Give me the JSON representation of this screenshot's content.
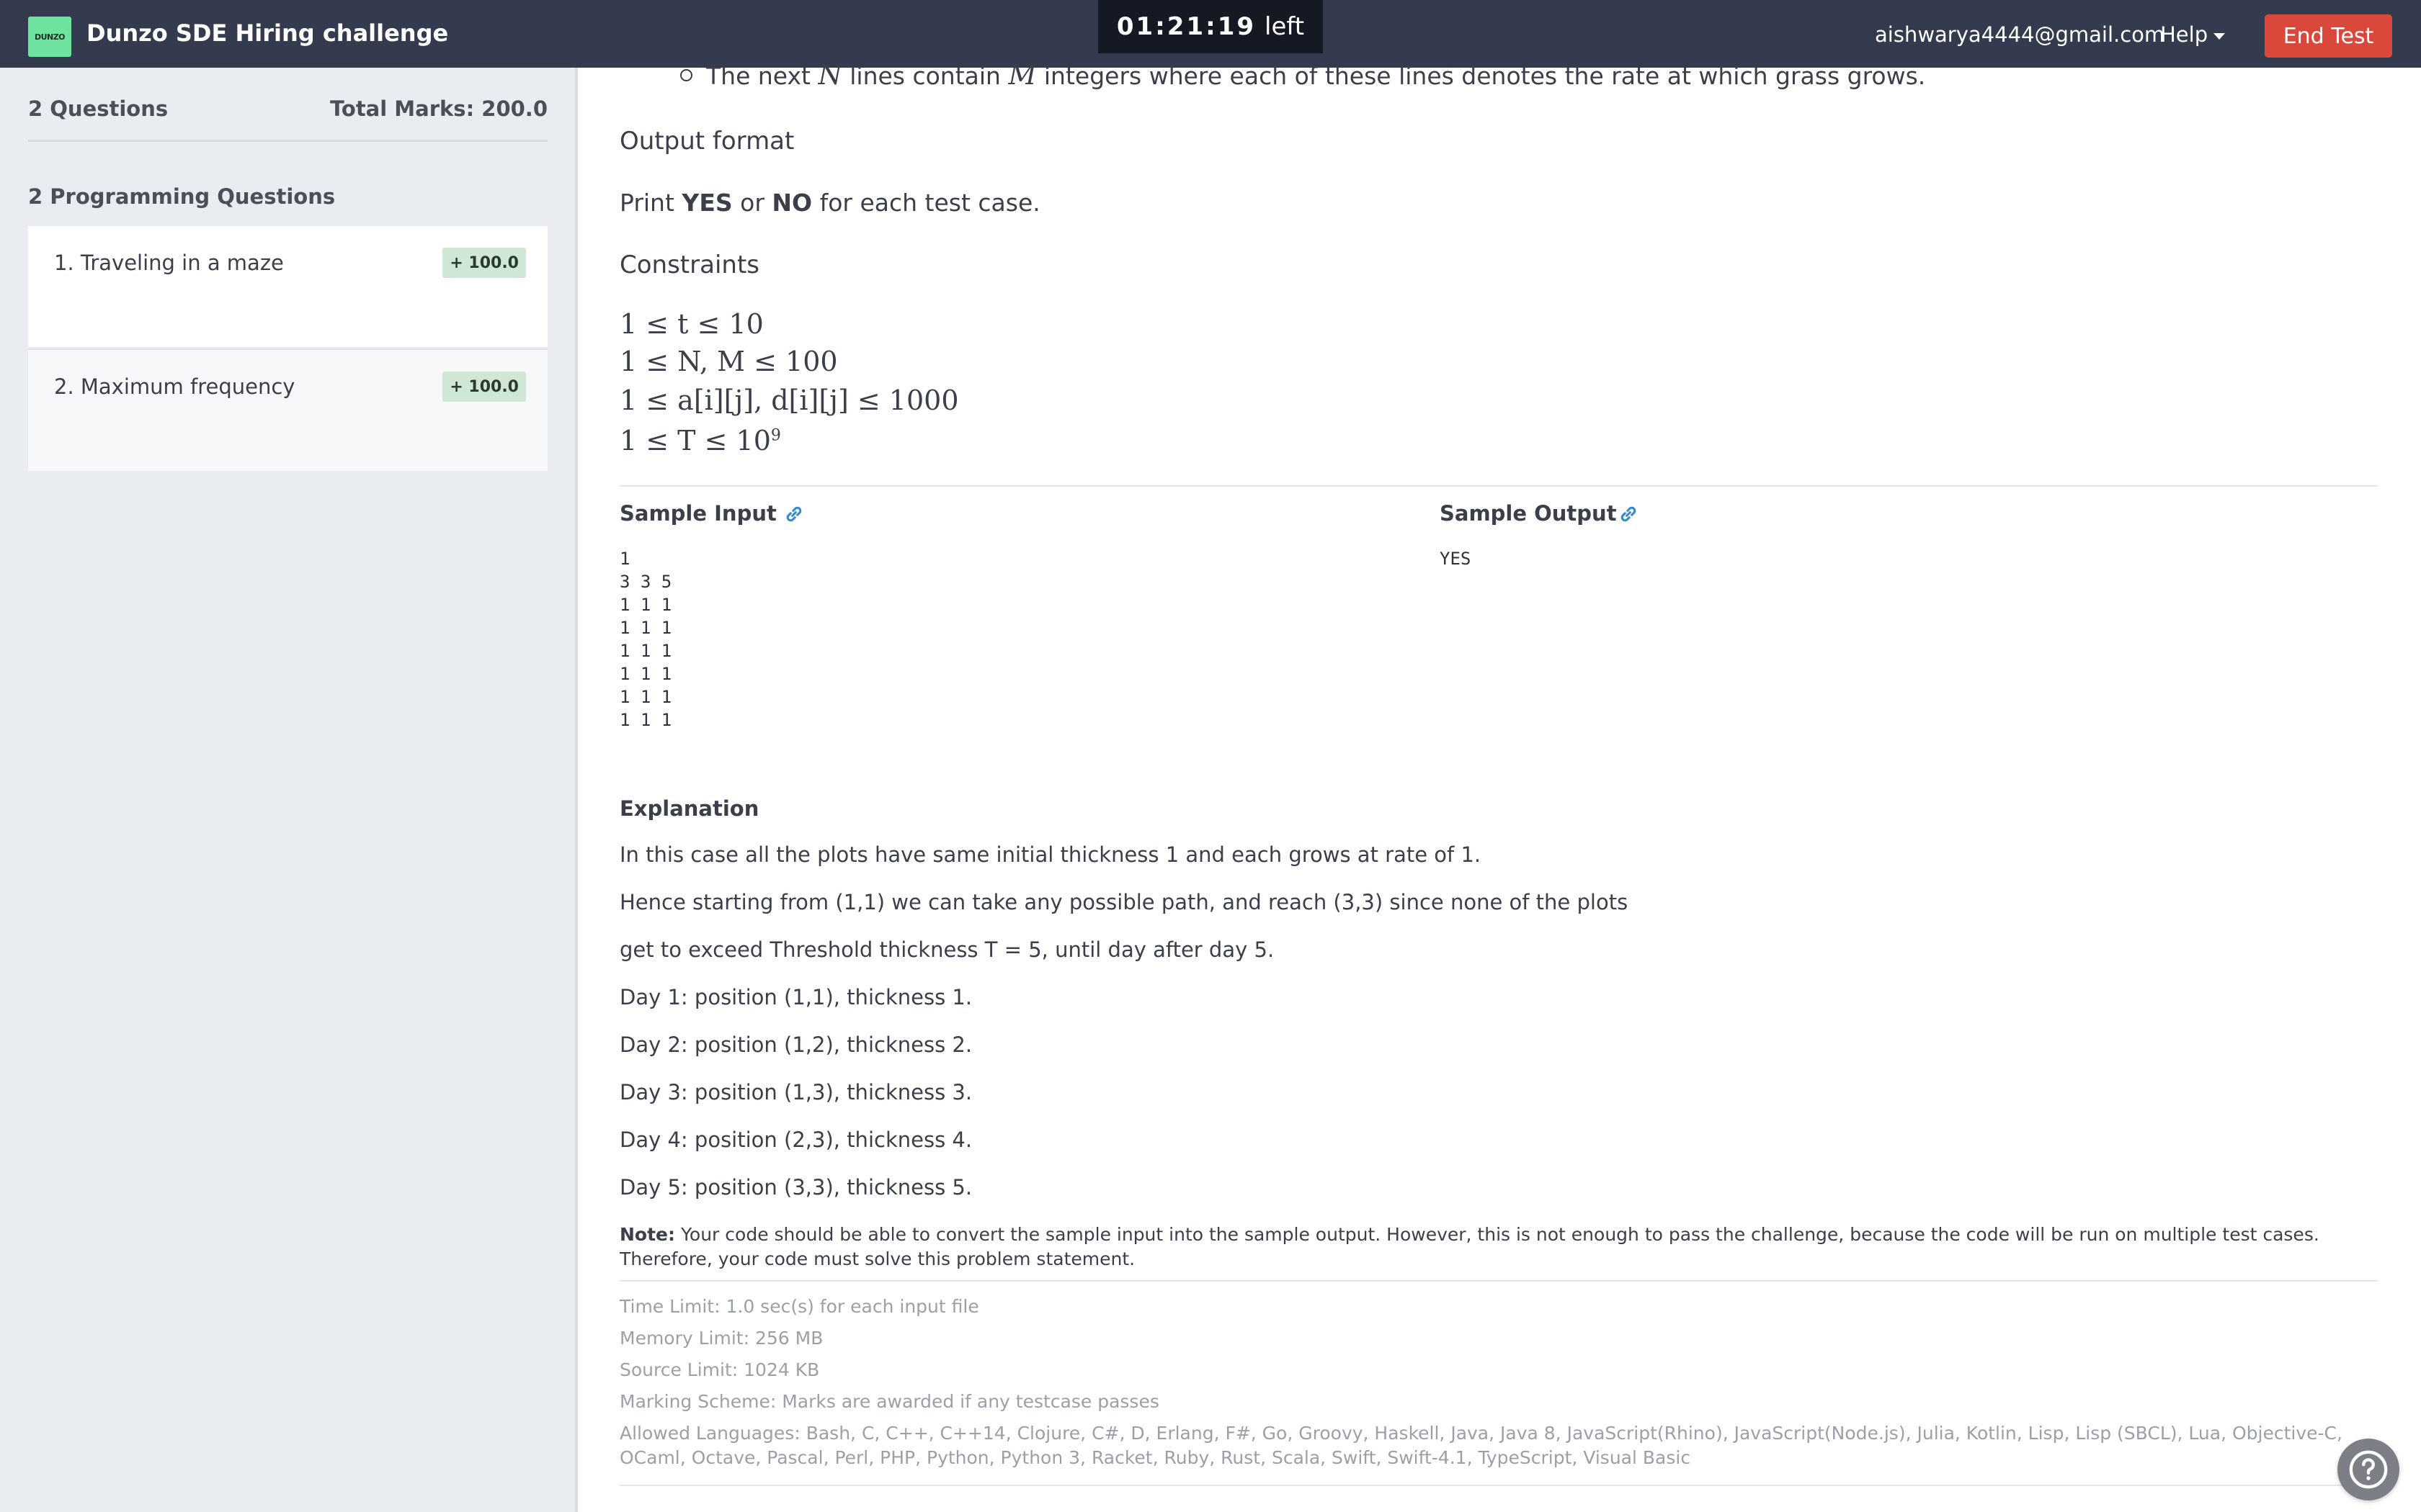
{
  "header": {
    "logo_text": "DUNZO",
    "title": "Dunzo SDE Hiring challenge",
    "timer_value": "01:21:19",
    "timer_suffix": "left",
    "user_email": "aishwarya4444@gmail.com",
    "help_label": "Help",
    "end_test_label": "End Test"
  },
  "sidebar": {
    "questions_count": "2 Questions",
    "total_marks": "Total Marks: 200.0",
    "section_title": "2 Programming Questions",
    "questions": [
      {
        "label": "1. Traveling in a maze",
        "marks": "+ 100.0"
      },
      {
        "label": "2. Maximum frequency",
        "marks": "+ 100.0"
      }
    ]
  },
  "problem": {
    "input_bullet": {
      "pre": "The next",
      "var1": "N",
      "mid": "lines contain",
      "var2": "M",
      "post": "integers where each of these lines denotes the rate at which grass grows."
    },
    "output_format_title": "Output format",
    "output_print": "Print",
    "output_yes": "YES",
    "output_or": "or",
    "output_no": "NO",
    "output_rest": "for each test case.",
    "constraints_title": "Constraints",
    "constraints": [
      "1 ≤ t ≤ 10",
      "1 ≤ N, M ≤ 100",
      "1 ≤ a[i][j], d[i][j] ≤ 1000",
      "1 ≤ T ≤ 10"
    ],
    "constraint_exponent": "9",
    "sample_input_label": "Sample Input",
    "sample_output_label": "Sample Output",
    "sample_input": "1\n3 3 5\n1 1 1\n1 1 1\n1 1 1\n1 1 1\n1 1 1\n1 1 1",
    "sample_output": "YES",
    "explanation_title": "Explanation",
    "explanation_lines": [
      "In this case all the plots have same initial thickness 1 and each grows at rate of 1.",
      "Hence starting from (1,1) we can take any possible path, and reach (3,3) since none of the plots",
      "get to exceed Threshold thickness T = 5, until day after day 5.",
      "Day 1: position (1,1), thickness 1.",
      "Day 2: position (1,2), thickness 2.",
      "Day 3: position (1,3), thickness 3.",
      "Day 4: position (2,3), thickness 4.",
      "Day 5: position (3,3), thickness 5."
    ],
    "note_label": "Note:",
    "note_text": "Your code should be able to convert the sample input into the sample output. However, this is not enough to pass the challenge, because the code will be run on multiple test cases. Therefore, your code must solve this problem statement.",
    "time_limit": "Time Limit: 1.0 sec(s) for each input file",
    "memory_limit": "Memory Limit: 256 MB",
    "source_limit": "Source Limit: 1024 KB",
    "marking_scheme": "Marking Scheme: Marks are awarded if any testcase passes",
    "allowed_languages": "Allowed Languages: Bash, C, C++, C++14, Clojure, C#, D, Erlang, F#, Go, Groovy, Haskell, Java, Java 8, JavaScript(Rhino), JavaScript(Node.js), Julia, Kotlin, Lisp, Lisp (SBCL), Lua, Objective-C, OCaml, Octave, Pascal, Perl, PHP, Python, Python 3, Racket, Ruby, Rust, Scala, Swift, Swift-4.1, TypeScript, Visual Basic"
  },
  "colors": {
    "topbar": "#353b4f",
    "timer_bg": "#151924",
    "end_button": "#d9483b",
    "logo": "#6ee39f",
    "badge": "#cfe8d6",
    "link": "#2f8ad8"
  },
  "icons": {
    "help_fab": "question-circle-icon",
    "sample_link": "link-icon",
    "help_caret": "caret-down-icon"
  }
}
